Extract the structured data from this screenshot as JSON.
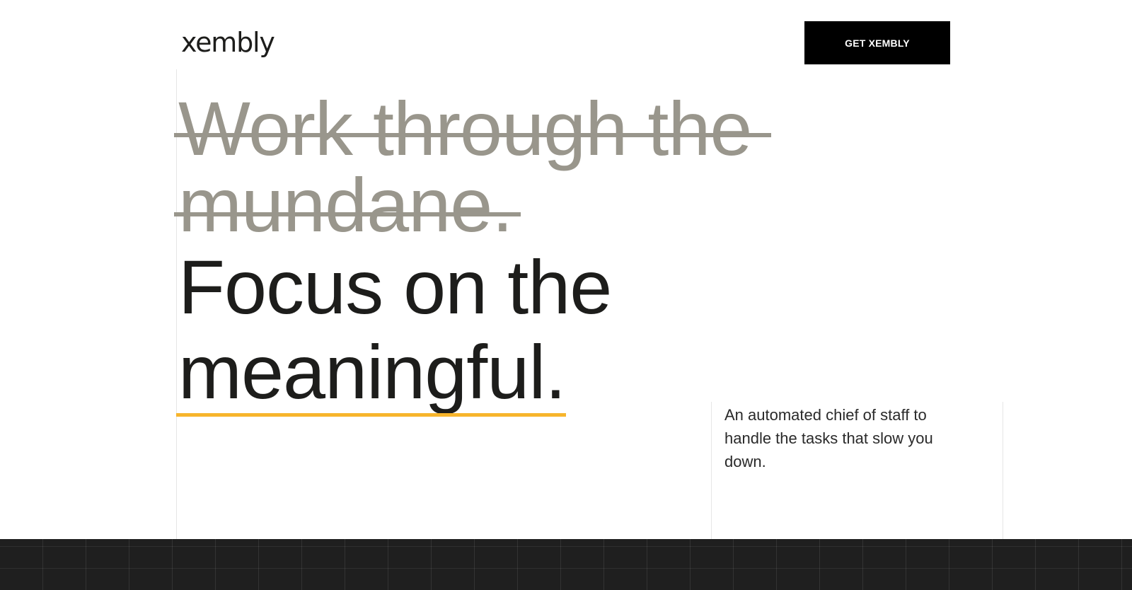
{
  "header": {
    "logo_text": "xembly",
    "cta_label": "GET XEMBLY"
  },
  "hero": {
    "struck_line_1": "Work through the",
    "struck_line_2": "mundane.",
    "focus_line_1": "Focus on the",
    "focus_line_2": "meaningful.",
    "description": "An automated chief of staff to handle the tasks that slow you down."
  },
  "colors": {
    "struck_text": "#99968c",
    "accent_underline": "#f7b52c",
    "button_background": "#000000",
    "footer_band": "#1f1f1f"
  }
}
